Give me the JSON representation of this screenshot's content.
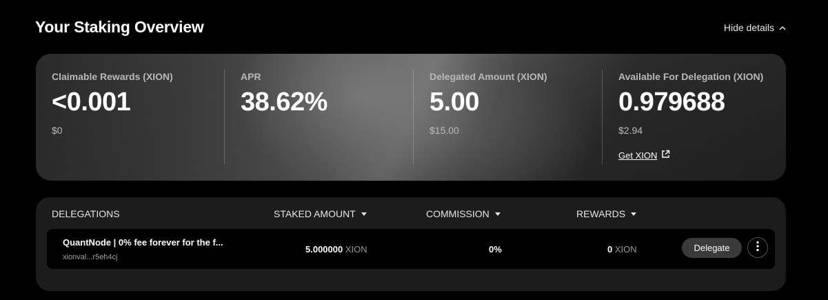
{
  "header": {
    "title": "Your Staking Overview",
    "toggle_label": "Hide details"
  },
  "overview": {
    "claimable": {
      "label": "Claimable Rewards (XION)",
      "value": "<0.001",
      "fiat": "$0"
    },
    "apr": {
      "label": "APR",
      "value": "38.62%"
    },
    "delegated": {
      "label": "Delegated Amount (XION)",
      "value": "5.00",
      "fiat": "$15.00"
    },
    "available": {
      "label": "Available For Delegation (XION)",
      "value": "0.979688",
      "fiat": "$2.94",
      "link_label": "Get XION"
    }
  },
  "delegations": {
    "columns": {
      "delegations": "DELEGATIONS",
      "staked": "STAKED AMOUNT",
      "commission": "COMMISSION",
      "rewards": "REWARDS"
    },
    "rows": [
      {
        "name": "QuantNode | 0% fee forever for the f...",
        "address": "xionval...r5eh4cj",
        "staked_amount": "5.000000",
        "staked_unit": "XION",
        "commission": "0%",
        "rewards_amount": "0",
        "rewards_unit": "XION",
        "delegate_label": "Delegate"
      }
    ]
  },
  "icons": {
    "toggle": "chevron-up-icon",
    "external": "external-link-icon",
    "sort": "caret-down-icon",
    "more": "more-vertical-icon"
  }
}
